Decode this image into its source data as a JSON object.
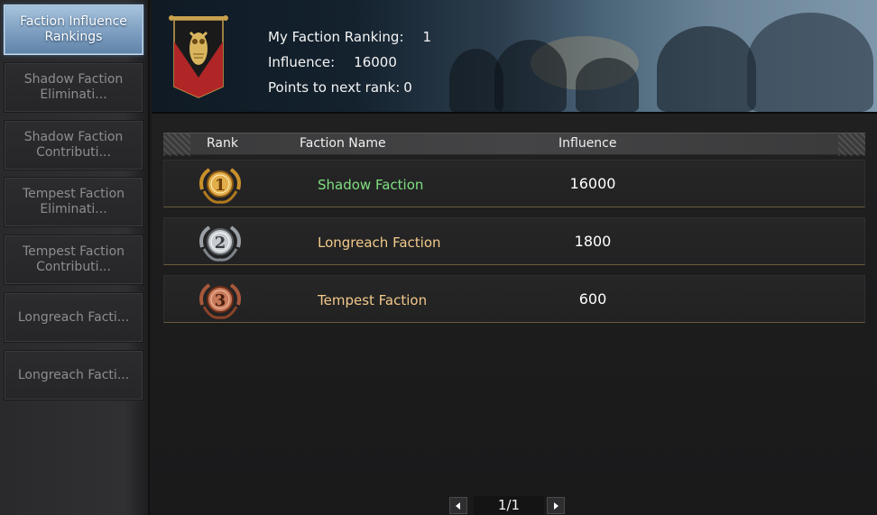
{
  "sidebar": {
    "items": [
      {
        "label": "Faction Influence Rankings",
        "active": true
      },
      {
        "label": "Shadow Faction Eliminati...",
        "active": false
      },
      {
        "label": "Shadow Faction Contributi...",
        "active": false
      },
      {
        "label": "Tempest Faction Eliminati...",
        "active": false
      },
      {
        "label": "Tempest Faction Contributi...",
        "active": false
      },
      {
        "label": "Longreach Facti...",
        "active": false
      },
      {
        "label": "Longreach Facti...",
        "active": false
      }
    ]
  },
  "header": {
    "ranking_label": "My Faction Ranking:",
    "ranking_value": "1",
    "influence_label": "Influence:",
    "influence_value": "16000",
    "next_rank_label": "Points to next rank:",
    "next_rank_value": "0",
    "emblem_icon": "owl-banner-icon"
  },
  "table": {
    "columns": {
      "rank": "Rank",
      "name": "Faction Name",
      "influence": "Influence"
    },
    "rows": [
      {
        "rank": "1",
        "medal": "gold-medal-icon",
        "name": "Shadow Faction",
        "influence": "16000",
        "name_color": "#7fe07f"
      },
      {
        "rank": "2",
        "medal": "silver-medal-icon",
        "name": "Longreach Faction",
        "influence": "1800",
        "name_color": "#f2c98a"
      },
      {
        "rank": "3",
        "medal": "bronze-medal-icon",
        "name": "Tempest Faction",
        "influence": "600",
        "name_color": "#f2c98a"
      }
    ]
  },
  "pager": {
    "page": "1/1"
  },
  "colors": {
    "accent": "#7d9ec0",
    "gold": "#d8a640",
    "silver": "#bfc4c9",
    "bronze": "#b86a4a"
  }
}
